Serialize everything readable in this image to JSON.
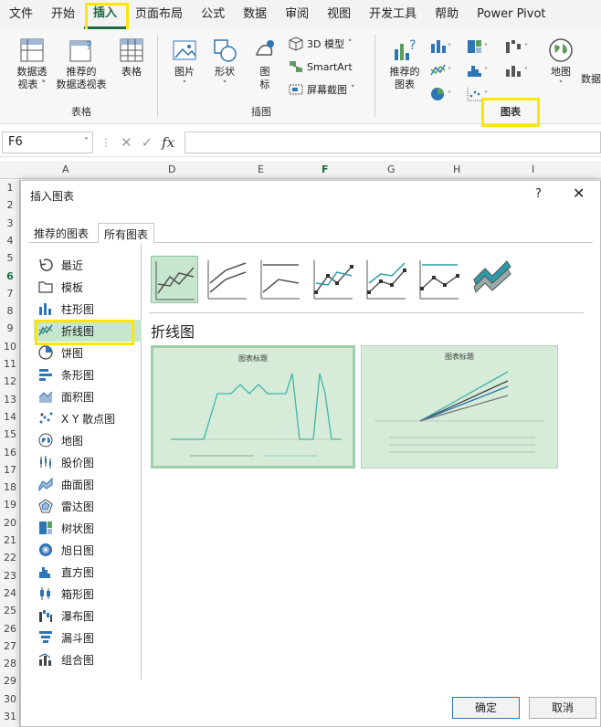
{
  "menu": [
    "文件",
    "开始",
    "插入",
    "页面布局",
    "公式",
    "数据",
    "审阅",
    "视图",
    "开发工具",
    "帮助",
    "Power Pivot"
  ],
  "ribbon": {
    "pivot_btn": [
      "数据透",
      "视表 ˅"
    ],
    "recommended_pivot_btn": [
      "推荐的",
      "数据透视表"
    ],
    "table_btn": "表格",
    "group_tables": "表格",
    "picture_btn": "图片",
    "shapes_btn": "形状",
    "icons_btn": [
      "图",
      "标"
    ],
    "model3d_btn": "3D 模型",
    "smartart_btn": "SmartArt",
    "screenshot_btn": "屏幕截图",
    "group_illustrations": "插图",
    "recommended_charts_btn": [
      "推荐的",
      "图表"
    ],
    "map_btn": "地图",
    "data_btn_partial": "数据",
    "group_charts": "图表"
  },
  "formula_bar": {
    "name_box": "F6",
    "fx": "fx",
    "formula": ""
  },
  "grid": {
    "columns": [
      "A",
      "D",
      "E",
      "F",
      "G",
      "H",
      "I"
    ],
    "rows": [
      "1",
      "2",
      "3",
      "4",
      "5",
      "6",
      "7",
      "8",
      "9",
      "10",
      "11",
      "12",
      "13",
      "14",
      "15",
      "16",
      "17",
      "18",
      "19",
      "20",
      "21",
      "22",
      "23",
      "24",
      "25",
      "26",
      "27",
      "28",
      "29",
      "30",
      "31"
    ],
    "selected_row": "6",
    "selected_col": "F"
  },
  "dialog": {
    "title": "插入图表",
    "help": "?",
    "close": "✕",
    "tabs": [
      "推荐的图表",
      "所有图表"
    ],
    "active_tab": 1,
    "chart_types": [
      {
        "label": "最近",
        "icon": "recent-icon"
      },
      {
        "label": "模板",
        "icon": "folder-icon"
      },
      {
        "label": "柱形图",
        "icon": "column-chart-icon"
      },
      {
        "label": "折线图",
        "icon": "line-chart-icon"
      },
      {
        "label": "饼图",
        "icon": "pie-chart-icon"
      },
      {
        "label": "条形图",
        "icon": "bar-chart-icon"
      },
      {
        "label": "面积图",
        "icon": "area-chart-icon"
      },
      {
        "label": "X Y 散点图",
        "icon": "scatter-chart-icon"
      },
      {
        "label": "地图",
        "icon": "map-chart-icon"
      },
      {
        "label": "股价图",
        "icon": "stock-chart-icon"
      },
      {
        "label": "曲面图",
        "icon": "surface-chart-icon"
      },
      {
        "label": "雷达图",
        "icon": "radar-chart-icon"
      },
      {
        "label": "树状图",
        "icon": "treemap-chart-icon"
      },
      {
        "label": "旭日图",
        "icon": "sunburst-chart-icon"
      },
      {
        "label": "直方图",
        "icon": "histogram-chart-icon"
      },
      {
        "label": "箱形图",
        "icon": "box-whisker-chart-icon"
      },
      {
        "label": "瀑布图",
        "icon": "waterfall-chart-icon"
      },
      {
        "label": "漏斗图",
        "icon": "funnel-chart-icon"
      },
      {
        "label": "组合图",
        "icon": "combo-chart-icon"
      }
    ],
    "selected_type": 3,
    "section_title": "折线图",
    "preview1_title": "图表标题",
    "preview2_title": "图表标题",
    "ok": "确定",
    "cancel": "取消"
  },
  "colors": {
    "accent": "#1e6b41",
    "highlight": "#ffe600",
    "selection": "#c6e6cf",
    "preview_bg": "#d6ecd9"
  }
}
